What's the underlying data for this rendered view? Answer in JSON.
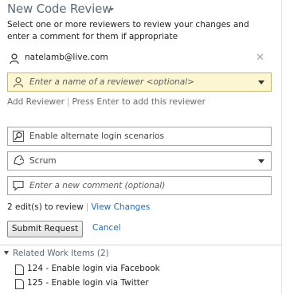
{
  "header": {
    "title": "New Code Review"
  },
  "instructions": "Select one or more reviewers to review your changes and enter a comment for them if appropriate",
  "reviewer": {
    "name": "natelamb@live.com",
    "remove_glyph": "✕"
  },
  "reviewer_input": {
    "placeholder": "Enter a name of a reviewer <optional>"
  },
  "add_reviewer": {
    "link_label": "Add Reviewer",
    "hint": "Press Enter to add this reviewer"
  },
  "title_field": {
    "value": "Enable alternate login scenarios"
  },
  "area_field": {
    "value": "Scrum"
  },
  "comment_field": {
    "placeholder": "Enter a new comment (optional)"
  },
  "edits": {
    "text": "2 edit(s) to review",
    "link": "View Changes"
  },
  "actions": {
    "submit": "Submit Request",
    "cancel": "Cancel"
  },
  "related": {
    "header": "Related Work Items (2)",
    "items": [
      {
        "label": "124 - Enable login via Facebook"
      },
      {
        "label": "125 - Enable login via Twitter"
      }
    ]
  }
}
